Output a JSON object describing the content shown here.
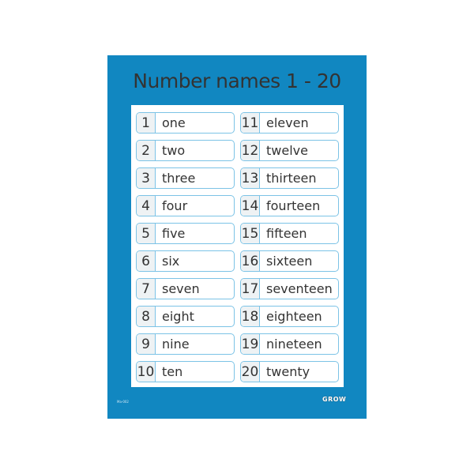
{
  "poster": {
    "title": "Number names 1 - 20",
    "background_color": "#1187c1",
    "card_border_color": "#7cc3e6",
    "code": "Ma-002",
    "logo": "GROW"
  },
  "numbers": [
    {
      "n": "1",
      "word": "one"
    },
    {
      "n": "11",
      "word": "eleven"
    },
    {
      "n": "2",
      "word": "two"
    },
    {
      "n": "12",
      "word": "twelve"
    },
    {
      "n": "3",
      "word": "three"
    },
    {
      "n": "13",
      "word": "thirteen"
    },
    {
      "n": "4",
      "word": "four"
    },
    {
      "n": "14",
      "word": "fourteen"
    },
    {
      "n": "5",
      "word": "five"
    },
    {
      "n": "15",
      "word": "fifteen"
    },
    {
      "n": "6",
      "word": "six"
    },
    {
      "n": "16",
      "word": "sixteen"
    },
    {
      "n": "7",
      "word": "seven"
    },
    {
      "n": "17",
      "word": "seventeen"
    },
    {
      "n": "8",
      "word": "eight"
    },
    {
      "n": "18",
      "word": "eighteen"
    },
    {
      "n": "9",
      "word": "nine"
    },
    {
      "n": "19",
      "word": "nineteen"
    },
    {
      "n": "10",
      "word": "ten"
    },
    {
      "n": "20",
      "word": "twenty"
    }
  ]
}
